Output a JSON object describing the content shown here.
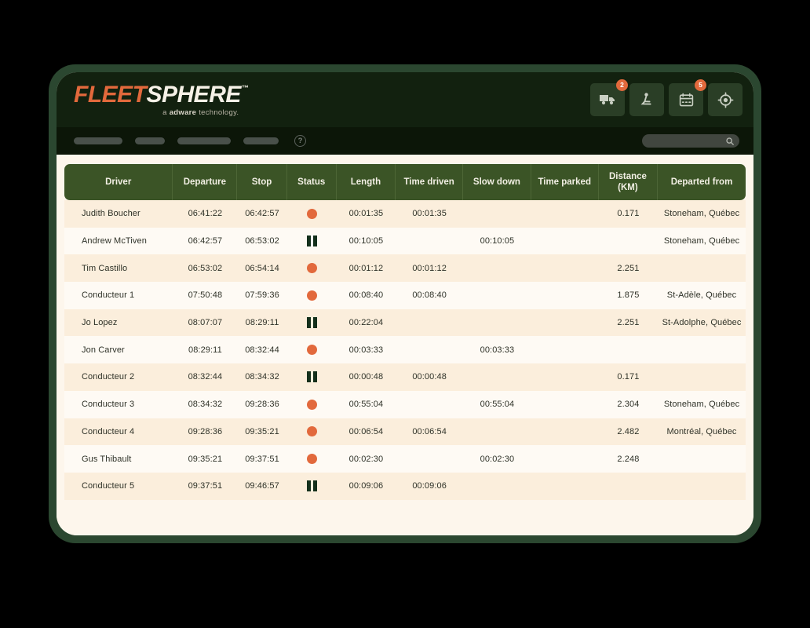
{
  "brand": {
    "name_part1": "FLEET",
    "name_part2": "SPHERE",
    "trademark": "™",
    "tagline_prefix": "a ",
    "tagline_bold": "adware",
    "tagline_suffix": " technology.",
    "accent_color": "#e2693c",
    "bezel_color": "#2b4730",
    "header_color": "#12210f",
    "table_header_color": "#3b5426"
  },
  "topbar": {
    "icons": [
      {
        "name": "truck-icon",
        "label": "Vehicles",
        "badge": "2"
      },
      {
        "name": "driver-icon",
        "label": "Drivers",
        "badge": ""
      },
      {
        "name": "calendar-icon",
        "label": "Schedule",
        "badge": "5"
      },
      {
        "name": "locate-icon",
        "label": "Locate",
        "badge": ""
      }
    ]
  },
  "navbar": {
    "items": [
      {
        "name": "nav-item-1",
        "label": ""
      },
      {
        "name": "nav-item-2",
        "label": ""
      },
      {
        "name": "nav-item-3",
        "label": ""
      },
      {
        "name": "nav-item-4",
        "label": ""
      }
    ],
    "help_label": "?",
    "search": {
      "value": "",
      "placeholder": ""
    }
  },
  "table": {
    "columns": [
      "Driver",
      "Departure",
      "Stop",
      "Status",
      "Length",
      "Time driven",
      "Slow down",
      "Time parked",
      "Distance\n(KM)",
      "Departed from"
    ],
    "column_distance_line1": "Distance",
    "column_distance_line2": "(KM)",
    "status_legend": {
      "driving": "driving",
      "parked": "parked"
    },
    "rows": [
      {
        "driver": "Judith Boucher",
        "departure": "06:41:22",
        "stop": "06:42:57",
        "status": "driving",
        "length": "00:01:35",
        "time_driven": "00:01:35",
        "slow_down": "",
        "time_parked": "",
        "distance": "0.171",
        "departed_from": "Stoneham, Québec"
      },
      {
        "driver": "Andrew McTiven",
        "departure": "06:42:57",
        "stop": "06:53:02",
        "status": "parked",
        "length": "00:10:05",
        "time_driven": "",
        "slow_down": "00:10:05",
        "time_parked": "",
        "distance": "",
        "departed_from": "Stoneham, Québec"
      },
      {
        "driver": "Tim Castillo",
        "departure": "06:53:02",
        "stop": "06:54:14",
        "status": "driving",
        "length": "00:01:12",
        "time_driven": "00:01:12",
        "slow_down": "",
        "time_parked": "",
        "distance": "2.251",
        "departed_from": ""
      },
      {
        "driver": "Conducteur 1",
        "departure": "07:50:48",
        "stop": "07:59:36",
        "status": "driving",
        "length": "00:08:40",
        "time_driven": "00:08:40",
        "slow_down": "",
        "time_parked": "",
        "distance": "1.875",
        "departed_from": "St-Adèle, Québec"
      },
      {
        "driver": "Jo Lopez",
        "departure": "08:07:07",
        "stop": "08:29:11",
        "status": "parked",
        "length": "00:22:04",
        "time_driven": "",
        "slow_down": "",
        "time_parked": "",
        "distance": "2.251",
        "departed_from": "St-Adolphe, Québec"
      },
      {
        "driver": "Jon Carver",
        "departure": "08:29:11",
        "stop": "08:32:44",
        "status": "driving",
        "length": "00:03:33",
        "time_driven": "",
        "slow_down": "00:03:33",
        "time_parked": "",
        "distance": "",
        "departed_from": ""
      },
      {
        "driver": "Conducteur 2",
        "departure": "08:32:44",
        "stop": "08:34:32",
        "status": "parked",
        "length": "00:00:48",
        "time_driven": "00:00:48",
        "slow_down": "",
        "time_parked": "",
        "distance": "0.171",
        "departed_from": ""
      },
      {
        "driver": "Conducteur 3",
        "departure": "08:34:32",
        "stop": "09:28:36",
        "status": "driving",
        "length": "00:55:04",
        "time_driven": "",
        "slow_down": "00:55:04",
        "time_parked": "",
        "distance": "2.304",
        "departed_from": "Stoneham, Québec"
      },
      {
        "driver": "Conducteur 4",
        "departure": "09:28:36",
        "stop": "09:35:21",
        "status": "driving",
        "length": "00:06:54",
        "time_driven": "00:06:54",
        "slow_down": "",
        "time_parked": "",
        "distance": "2.482",
        "departed_from": "Montréal, Québec"
      },
      {
        "driver": "Gus Thibault",
        "departure": "09:35:21",
        "stop": "09:37:51",
        "status": "driving",
        "length": "00:02:30",
        "time_driven": "",
        "slow_down": "00:02:30",
        "time_parked": "",
        "distance": "2.248",
        "departed_from": ""
      },
      {
        "driver": "Conducteur 5",
        "departure": "09:37:51",
        "stop": "09:46:57",
        "status": "parked",
        "length": "00:09:06",
        "time_driven": "00:09:06",
        "slow_down": "",
        "time_parked": "",
        "distance": "",
        "departed_from": ""
      }
    ]
  }
}
